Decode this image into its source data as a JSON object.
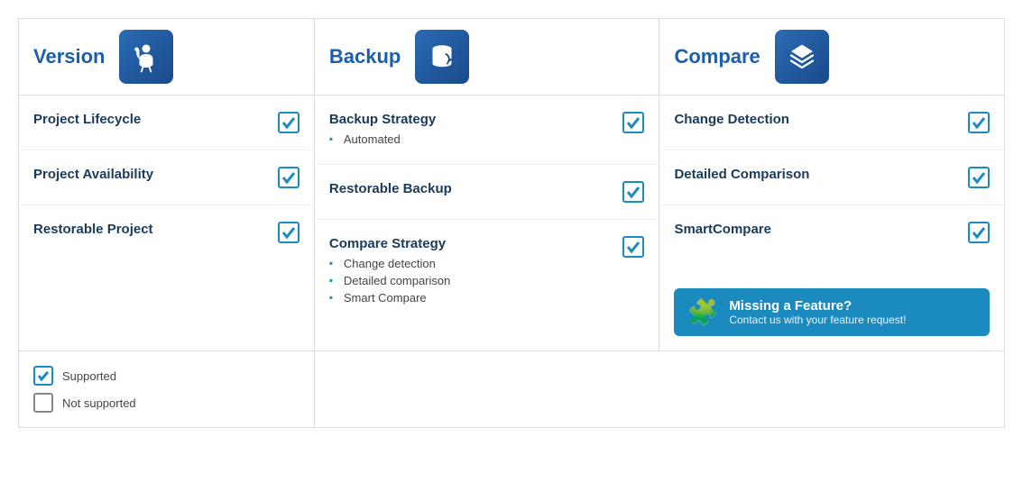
{
  "header": {
    "version_label": "Version",
    "backup_label": "Backup",
    "compare_label": "Compare"
  },
  "version_features": [
    {
      "name": "Project Lifecycle",
      "checked": true
    },
    {
      "name": "Project Availability",
      "checked": true
    },
    {
      "name": "Restorable Project",
      "checked": true
    }
  ],
  "backup_features": [
    {
      "name": "Backup Strategy",
      "checked": true,
      "subitems": [
        "Automated"
      ]
    },
    {
      "name": "Restorable Backup",
      "checked": true,
      "subitems": []
    },
    {
      "name": "Compare Strategy",
      "checked": true,
      "subitems": [
        "Change detection",
        "Detailed comparison",
        "Smart Compare"
      ]
    }
  ],
  "compare_features": [
    {
      "name": "Change Detection",
      "checked": true
    },
    {
      "name": "Detailed Comparison",
      "checked": true
    },
    {
      "name": "SmartCompare",
      "checked": true
    }
  ],
  "legend": {
    "supported_label": "Supported",
    "not_supported_label": "Not supported"
  },
  "missing_banner": {
    "title": "Missing a Feature?",
    "subtitle": "Contact us with your feature request!"
  }
}
